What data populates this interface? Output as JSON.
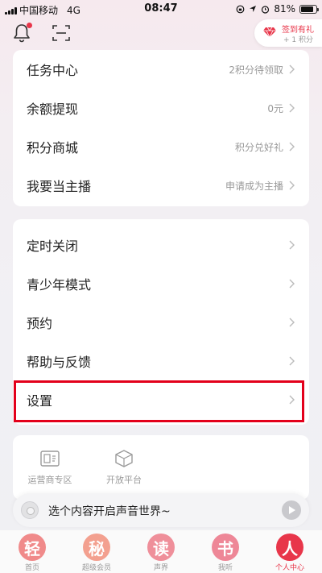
{
  "status_bar": {
    "carrier": "中国移动",
    "network": "4G",
    "time": "08:47",
    "battery": "81%",
    "battery_level": 0.81
  },
  "signin_badge": {
    "title": "签到有礼",
    "subtitle": "+ 1 积分"
  },
  "account_menu": [
    {
      "label": "任务中心",
      "value": "2积分待领取"
    },
    {
      "label": "余额提现",
      "value": "0元"
    },
    {
      "label": "积分商城",
      "value": "积分兑好礼"
    },
    {
      "label": "我要当主播",
      "value": "申请成为主播"
    }
  ],
  "settings_menu": [
    {
      "label": "定时关闭"
    },
    {
      "label": "青少年模式"
    },
    {
      "label": "预约"
    },
    {
      "label": "帮助与反馈"
    },
    {
      "label": "设置"
    }
  ],
  "services": [
    {
      "label": "运营商专区",
      "icon": "sim-card-icon"
    },
    {
      "label": "开放平台",
      "icon": "cube-icon"
    }
  ],
  "player": {
    "text": "选个内容开启声音世界~"
  },
  "tabs": [
    {
      "label": "首页",
      "glyph": "轻",
      "color": "#f08a8a"
    },
    {
      "label": "超级会员",
      "glyph": "秘",
      "color": "#f3a08f"
    },
    {
      "label": "声界",
      "glyph": "读",
      "color": "#ef8f9a"
    },
    {
      "label": "我听",
      "glyph": "书",
      "color": "#ee8797"
    },
    {
      "label": "个人中心",
      "glyph": "人",
      "color": "#e8364a",
      "active": true
    }
  ],
  "colors": {
    "accent": "#e8364a",
    "highlight_border": "#e3001b"
  }
}
